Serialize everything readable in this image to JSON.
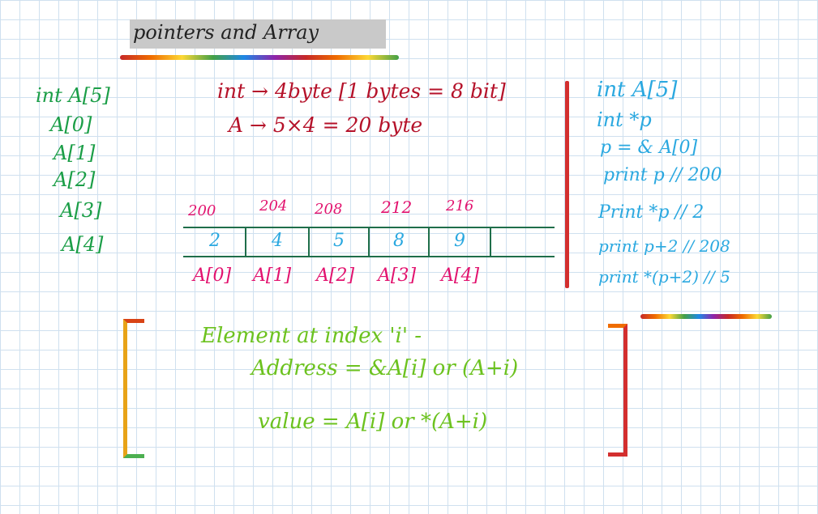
{
  "title": "pointers and Array",
  "left_list": {
    "decl": "int A[5]",
    "items": [
      "A[0]",
      "A[1]",
      "A[2]",
      "A[3]",
      "A[4]"
    ]
  },
  "size_notes": {
    "line1": "int → 4byte [1 bytes = 8 bit]",
    "line2": "A → 5×4 = 20 byte"
  },
  "array_diagram": {
    "addresses": [
      "200",
      "204",
      "208",
      "212",
      "216"
    ],
    "values": [
      "2",
      "4",
      "5",
      "8",
      "9"
    ],
    "labels": [
      "A[0]",
      "A[1]",
      "A[2]",
      "A[3]",
      "A[4]"
    ]
  },
  "code_notes": {
    "line1": "int A[5]",
    "line2": "int *p",
    "line3": "p = & A[0]",
    "line4": "print p // 200",
    "line5": "Print *p // 2",
    "line6": "print p+2 // 208",
    "line7": "print *(p+2) // 5"
  },
  "box": {
    "heading": "Element at index 'i' -",
    "address_line": "Address = &A[i] or (A+i)",
    "value_line": "value = A[i] or *(A+i)"
  },
  "colors": {
    "title": "#222222",
    "left_list": "#1b9e47",
    "size_notes": "#b5122a",
    "addresses": "#e2126e",
    "values": "#2aa8e0",
    "box_text": "#6cc21f",
    "divider": "#d32f2f"
  }
}
